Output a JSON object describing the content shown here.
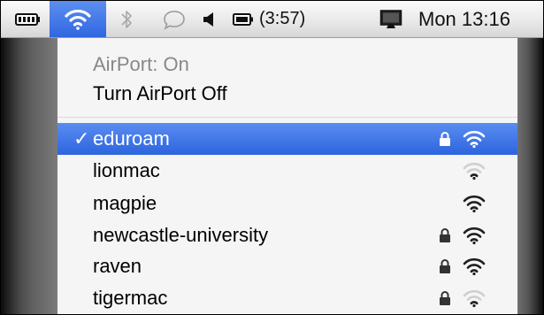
{
  "menubar": {
    "battery_text": "(3:57)",
    "clock": "Mon 13:16",
    "icons": [
      "battery-icon",
      "wifi-icon",
      "bluetooth-icon",
      "speech-icon",
      "volume-icon",
      "battery-status-icon",
      "display-icon"
    ]
  },
  "menu": {
    "status": "AirPort: On",
    "toggle": "Turn AirPort Off",
    "networks": [
      {
        "name": "eduroam",
        "selected": true,
        "locked": true,
        "signal": 3
      },
      {
        "name": "lionmac",
        "selected": false,
        "locked": false,
        "signal": 1
      },
      {
        "name": "magpie",
        "selected": false,
        "locked": false,
        "signal": 3
      },
      {
        "name": "newcastle-university",
        "selected": false,
        "locked": true,
        "signal": 3
      },
      {
        "name": "raven",
        "selected": false,
        "locked": true,
        "signal": 3
      },
      {
        "name": "tigermac",
        "selected": false,
        "locked": true,
        "signal": 1
      }
    ],
    "check_glyph": "✓"
  },
  "colors": {
    "selection": "#3b74e6",
    "menu_background": "#f5f5f5",
    "disabled_text": "#888888"
  }
}
